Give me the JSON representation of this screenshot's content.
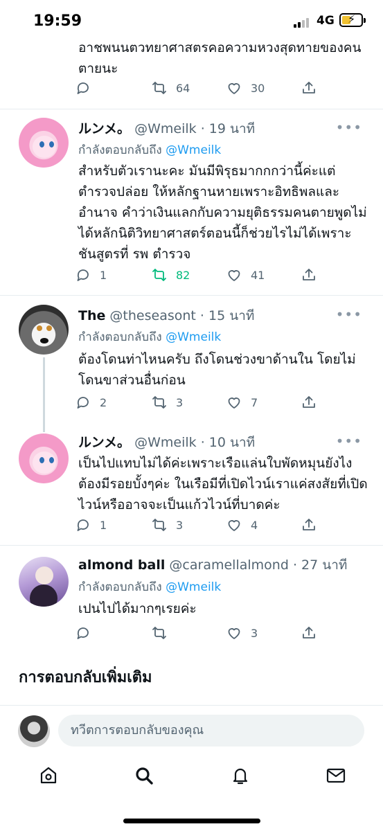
{
  "status": {
    "time": "19:59",
    "network": "4G"
  },
  "top_tail": {
    "text": "อาชพนนตวทยาศาสตรคอความหวงสุดทายของคนตายนะ",
    "replies": "",
    "retweets": "64",
    "likes": "30"
  },
  "tweets": [
    {
      "name": "ルンメ。",
      "handle": "@Wmeilk",
      "time": "· 19 นาที",
      "replying_prefix": "กำลังตอบกลับถึง",
      "replying_to": "@Wmeilk",
      "text": "สำหรับตัวเรานะคะ มันมีพิรุธมากกกว่านี้ค่ะแต่ตำรวจปล่อย ให้หลักฐานหายเพราะอิทธิพลและอำนาจ คำว่าเงินแลกกับความยุติธรรมคนตายพูดไม่ได้หลักนิติวิทยาศาสตร์ตอนนี้ก็ช่วยไรไม่ได้เพราะชันสูตรที่ รพ ตำรวจ",
      "replies": "1",
      "retweets": "82",
      "likes": "41",
      "retweeted": true
    },
    {
      "name": "The",
      "handle": "@theseasont",
      "time": "· 15 นาที",
      "replying_prefix": "กำลังตอบกลับถึง",
      "replying_to": "@Wmeilk",
      "text": "ต้องโดนท่าไหนครับ ถึงโดนช่วงขาด้านใน โดยไม่โดนขาส่วนอื่นก่อน",
      "replies": "2",
      "retweets": "3",
      "likes": "7",
      "retweeted": false
    },
    {
      "name": "ルンメ。",
      "handle": "@Wmeilk",
      "time": "· 10 นาที",
      "replying_prefix": "",
      "replying_to": "",
      "text": "เป็นไปแทบไม่ได้ค่ะเพราะเรือแล่นใบพัดหมุนยังไงต้องมีรอยบั้งๆค่ะ ในเรือมีที่เปิดไวน์เราแค่สงสัยที่เปิดไวน์หรืออาจจะเป็นแก้วไวน์ที่บาดค่ะ",
      "replies": "1",
      "retweets": "3",
      "likes": "4",
      "retweeted": false
    },
    {
      "name": "almond ball",
      "handle": "@caramellalmond",
      "time": "· 27 นาที",
      "replying_prefix": "กำลังตอบกลับถึง",
      "replying_to": "@Wmeilk",
      "text": "เปนไปได้มากๆเรยค่ะ",
      "replies": "",
      "retweets": "",
      "likes": "3",
      "retweeted": false
    }
  ],
  "more_replies_title": "การตอบกลับเพิ่มเติม",
  "compose": {
    "placeholder": "ทวีตการตอบกลับของคุณ"
  },
  "colors": {
    "accent": "#1d9bf0",
    "retweet_active": "#00ba7c",
    "muted": "#536471"
  },
  "icons": [
    "home-icon",
    "search-icon",
    "bell-icon",
    "mail-icon",
    "reply-icon",
    "retweet-icon",
    "like-icon",
    "share-icon",
    "more-icon"
  ]
}
